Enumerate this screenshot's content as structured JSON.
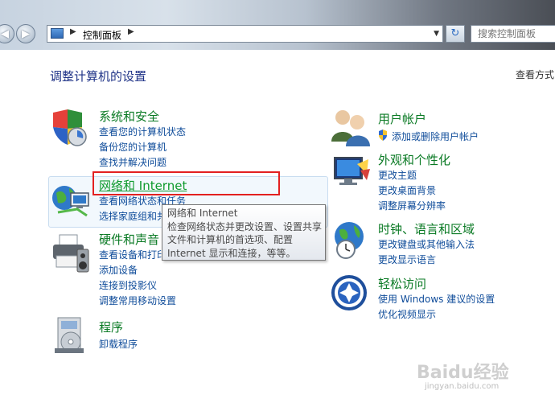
{
  "address_bar": {
    "path_label": "控制面板",
    "search_placeholder": "搜索控制面板"
  },
  "page": {
    "title": "调整计算机的设置",
    "view_by": "查看方式"
  },
  "categories": {
    "security": {
      "title": "系统和安全",
      "links": [
        "查看您的计算机状态",
        "备份您的计算机",
        "查找并解决问题"
      ]
    },
    "network": {
      "title": "网络和 Internet",
      "links": [
        "查看网络状态和任务",
        "选择家庭组和共享选项"
      ]
    },
    "hardware": {
      "title": "硬件和声音",
      "links": [
        "查看设备和打印机",
        "添加设备",
        "连接到投影仪",
        "调整常用移动设置"
      ]
    },
    "programs": {
      "title": "程序",
      "links": [
        "卸载程序"
      ]
    },
    "user_accounts": {
      "title": "用户帐户",
      "links": [
        "添加或删除用户帐户"
      ]
    },
    "appearance": {
      "title": "外观和个性化",
      "links": [
        "更改主题",
        "更改桌面背景",
        "调整屏幕分辨率"
      ]
    },
    "clock": {
      "title": "时钟、语言和区域",
      "links": [
        "更改键盘或其他输入法",
        "更改显示语言"
      ]
    },
    "ease": {
      "title": "轻松访问",
      "links": [
        "使用 Windows 建议的设置",
        "优化视频显示"
      ]
    }
  },
  "tooltip": {
    "lines": [
      "网络和 Internet",
      "检查网络状态并更改设置、设置共享",
      "文件和计算机的首选项、配置",
      "Internet 显示和连接，等等。"
    ]
  },
  "watermark": {
    "main": "Baidu经验",
    "sub": "jingyan.baidu.com"
  },
  "colors": {
    "category_title": "#0a7a24",
    "link": "#0f4c9a",
    "highlight_box": "#e32020"
  }
}
